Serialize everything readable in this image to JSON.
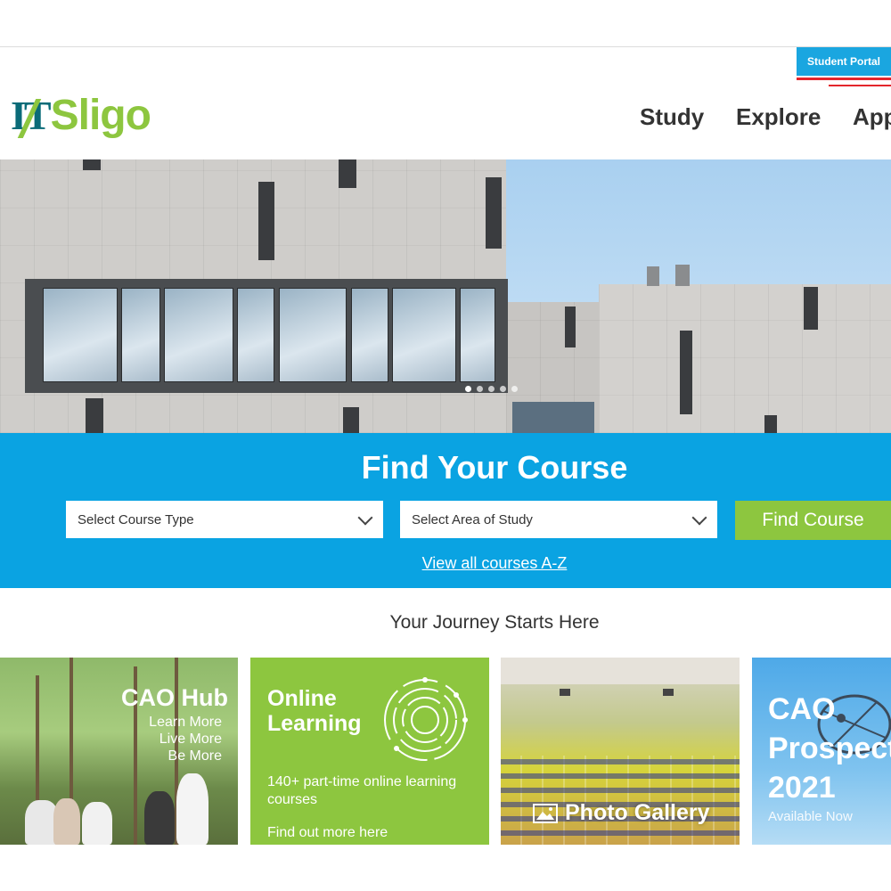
{
  "header": {
    "portal_button": "Student Portal",
    "logo_it": "IT",
    "logo_name": "Sligo",
    "nav": [
      "Study",
      "Explore",
      "App"
    ]
  },
  "hero": {
    "slide_count": 5,
    "active_slide": 1
  },
  "finder": {
    "title": "Find Your Course",
    "course_type_placeholder": "Select Course Type",
    "area_placeholder": "Select Area of Study",
    "button": "Find Course",
    "az_link": "View all courses A-Z"
  },
  "journey": {
    "heading": "Your Journey Starts Here",
    "tiles": [
      {
        "title": "CAO Hub",
        "lines": [
          "Learn More",
          "Live More",
          "Be More"
        ]
      },
      {
        "title_l1": "Online",
        "title_l2": "Learning",
        "body": "140+ part-time online learning courses",
        "cta": "Find out more here"
      },
      {
        "title": "Photo Gallery"
      },
      {
        "title_l1": "CAO",
        "title_l2": "Prospect",
        "title_l3": "2021",
        "sub": "Available Now"
      }
    ]
  },
  "colors": {
    "brand_blue": "#0aa3e2",
    "brand_green": "#8dc63f",
    "logo_teal": "#0a6b78",
    "portal_underline": "#e4262c"
  }
}
